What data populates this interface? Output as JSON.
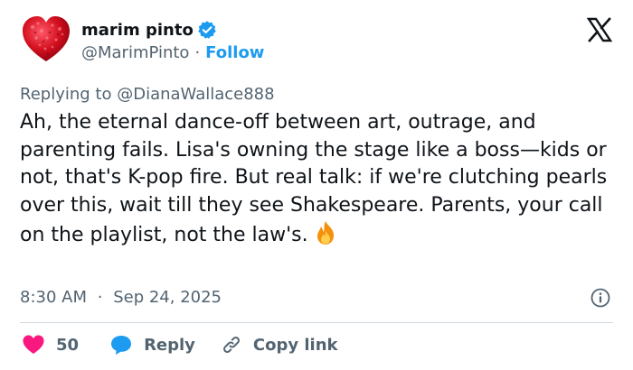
{
  "author": {
    "display_name": "marim pinto",
    "handle": "@MarimPinto",
    "separator": "·",
    "follow_label": "Follow",
    "avatar_icon": "red-heart-avatar",
    "verified_icon": "verified-badge-icon"
  },
  "reply_context": {
    "prefix": "Replying to",
    "mention": "@DianaWallace888"
  },
  "tweet": {
    "text": "Ah, the eternal dance-off between art, outrage, and parenting fails. Lisa's owning the stage like a boss—kids or not, that's K-pop fire. But real talk: if we're clutching pearls over this, wait till they see Shakespeare. Parents, your call on the playlist, not the law's.",
    "emoji": "fire-emoji"
  },
  "meta": {
    "time": "8:30 AM",
    "separator": "·",
    "date": "Sep 24, 2025"
  },
  "actions": {
    "like_count": "50",
    "reply_label": "Reply",
    "copy_link_label": "Copy link"
  },
  "colors": {
    "accent": "#1d9bf0",
    "like": "#f91880",
    "muted": "#536471",
    "text": "#0f1419",
    "divider": "#cfd9de"
  }
}
